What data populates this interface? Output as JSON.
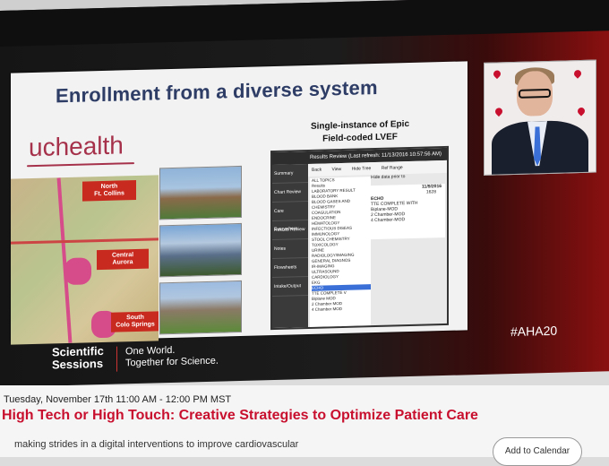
{
  "slide": {
    "title": "Enrollment from a diverse system",
    "brand": "uchealth",
    "map_labels": [
      {
        "line1": "North",
        "line2": "Ft. Collins"
      },
      {
        "line1": "Central",
        "line2": "Aurora"
      },
      {
        "line1": "South",
        "line2": "Colo Springs"
      }
    ],
    "epic_title_line1": "Single-instance of Epic",
    "epic_title_line2": "Field-coded LVEF",
    "epic": {
      "window_title": "Results Review (Last refresh: 11/13/2016 10:57:56 AM)",
      "toolbar": [
        "Back",
        "View",
        "Hide Tree",
        "Ref Range"
      ],
      "hide_prior": "Hide data prior to",
      "sidebar": [
        "Summary",
        "Chart Review",
        "Care Everywhere",
        "Results Review",
        "Notes",
        "Flowsheets",
        "Intake/Output"
      ],
      "tree": [
        "ALL TOPICS",
        "Results",
        "LABORATORY RESULT",
        "BLOOD BANK",
        "BLOOD GASES AND",
        "CHEMISTRY",
        "COAGULATION",
        "ENDOCRINE",
        "HEMATOLOGY",
        "INFECTIOUS DISEAS",
        "IMMUNOLOGY",
        "STOOL CHEMISTRY",
        "TOXICOLOGY",
        "URINE",
        "RADIOLOGY/IMAGING",
        "GENERAL DIAGNOS",
        "IR-IMAGING",
        "ULTRASOUND",
        "CARDIOLOGY",
        "EKG",
        "ECHO",
        "TTE COMPLETE V",
        "Biplane MOD",
        "2 Chamber MOD",
        "4 Chamber MOD"
      ],
      "grid_date": "11/9/2016",
      "grid_time": "1628",
      "grid_rows": [
        "ECHO",
        "TTE COMPLETE WITH",
        "Biplane-MOD",
        "2 Chamber-MOD",
        "4 Chamber-MOD"
      ]
    }
  },
  "footer": {
    "logo_line1": "Scientific",
    "logo_line2": "Sessions",
    "tag_line1": "One World.",
    "tag_line2": "Together for Science.",
    "hashtag": "#AHA20"
  },
  "session": {
    "time": "Tuesday, November 17th 11:00 AM - 12:00 PM MST",
    "title": "High Tech or High Touch: Creative Strategies to Optimize Patient Care",
    "description": "making strides in a digital interventions to improve cardiovascular",
    "add_calendar": "Add to Calendar"
  },
  "colors": {
    "accent_red": "#c8102e",
    "slide_title": "#2e3d66",
    "brand": "#a5324a"
  }
}
